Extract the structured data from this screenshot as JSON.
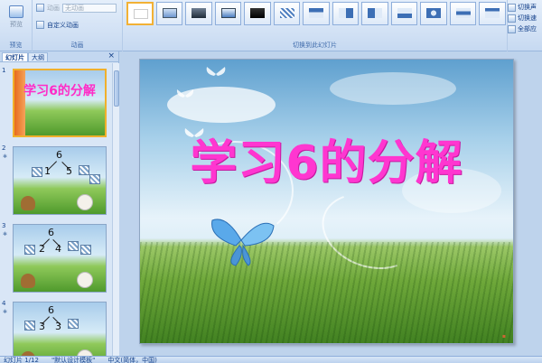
{
  "ribbon": {
    "preview_label": "预览",
    "preview_group_label": "预览",
    "animate_label": "动画",
    "animate_value": "无动画",
    "custom_anim_label": "自定义动画",
    "anim_group_label": "动画",
    "transition_group_label": "切换到此幻灯片",
    "right_items": [
      "切换声",
      "切换速",
      "全部应"
    ]
  },
  "pane": {
    "tab_slides": "幻灯片",
    "tab_outline": "大纲",
    "close": "×"
  },
  "slides": [
    {
      "num": "1",
      "title": "学习6的分解"
    },
    {
      "num": "2",
      "top": "6",
      "left": "1",
      "right": "5"
    },
    {
      "num": "3",
      "top": "6",
      "left": "2",
      "right": "4"
    },
    {
      "num": "4",
      "top": "6",
      "left": "3",
      "right": "3"
    }
  ],
  "main": {
    "title": "学习6的分解"
  },
  "status": {
    "slide_info": "幻灯片 1/12",
    "theme": "\"默认设计模板\"",
    "language": "中文(简体，中国)"
  },
  "colors": {
    "title_pink": "#ff36d0",
    "selection_orange": "#f0b02c"
  }
}
